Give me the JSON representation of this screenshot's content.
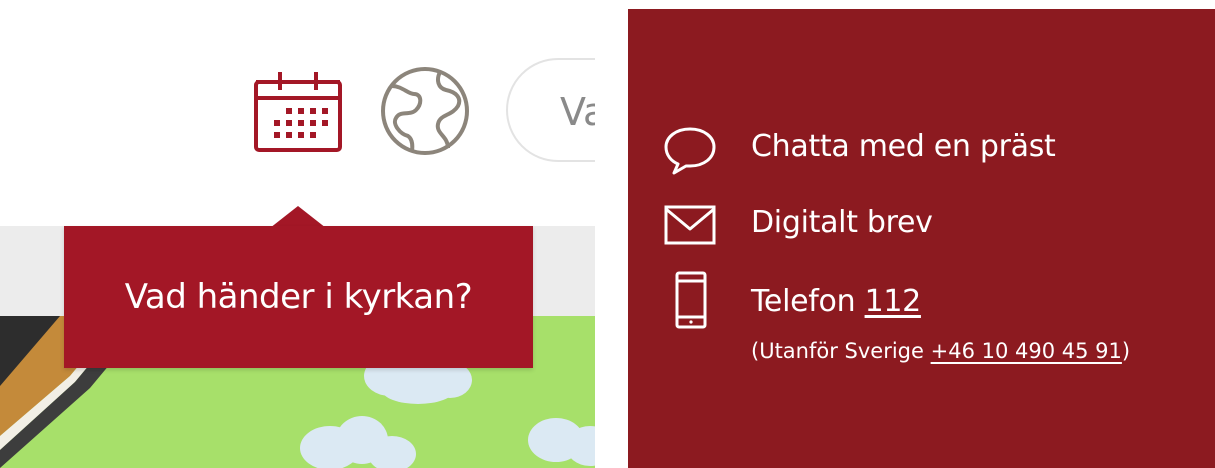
{
  "header": {
    "search_placeholder": "Va",
    "icons": [
      "calendar-icon",
      "globe-icon"
    ]
  },
  "tooltip": {
    "text": "Vad händer i kyrkan?"
  },
  "contact": {
    "chat_label": "Chatta med en präst",
    "letter_label": "Digitalt brev",
    "phone_label": "Telefon",
    "phone_number": "112",
    "abroad_prefix": "(Utanför Sverige ",
    "abroad_number": "+46 10 490 45 91",
    "abroad_suffix": ")",
    "icons": [
      "chat-bubble-icon",
      "envelope-icon",
      "mobile-phone-icon"
    ]
  },
  "colors": {
    "brand_red": "#a31726",
    "panel_red": "#8c1a20",
    "globe_gray": "#8c857b"
  }
}
